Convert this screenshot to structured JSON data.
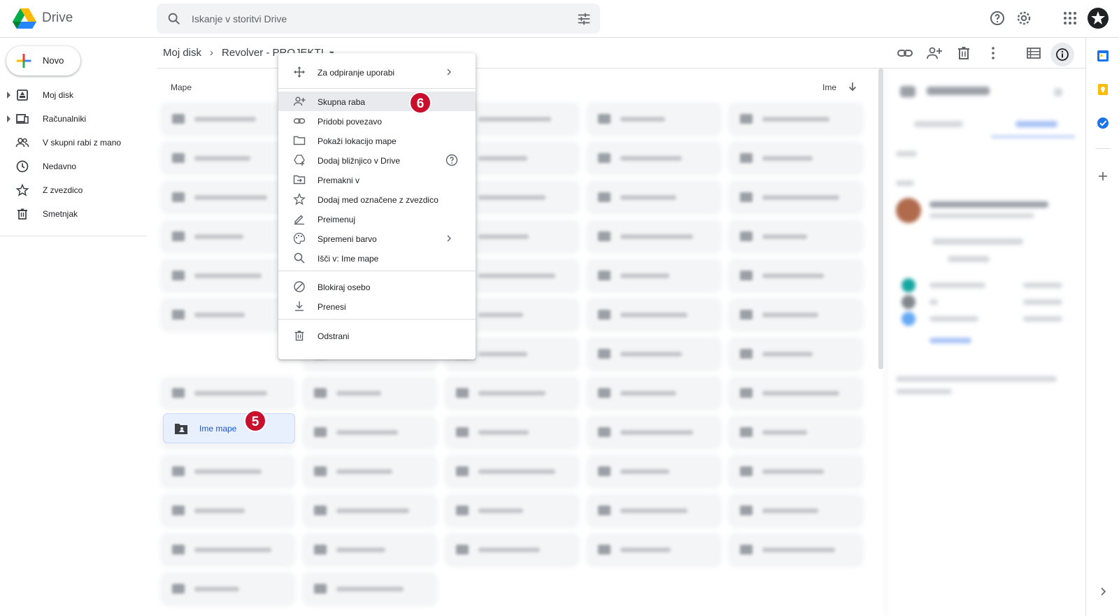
{
  "app": {
    "name": "Drive"
  },
  "search": {
    "placeholder": "Iskanje v storitvi Drive"
  },
  "left_nav": {
    "new_label": "Novo",
    "items": [
      {
        "label": "Moj disk",
        "icon": "my-drive-icon",
        "expandable": true
      },
      {
        "label": "Računalniki",
        "icon": "computers-icon",
        "expandable": true
      },
      {
        "label": "V skupni rabi z mano",
        "icon": "shared-with-me-icon",
        "expandable": false
      },
      {
        "label": "Nedavno",
        "icon": "clock-icon",
        "expandable": false
      },
      {
        "label": "Z zvezdico",
        "icon": "star-icon",
        "expandable": false
      },
      {
        "label": "Smetnjak",
        "icon": "trash-icon",
        "expandable": false
      }
    ]
  },
  "breadcrumb": {
    "root": "Moj disk",
    "current": "Revolver - PROJEKTI"
  },
  "content": {
    "section_label": "Mape",
    "sort_label": "Ime",
    "selected_folder": "Ime mape"
  },
  "badges": {
    "folder": "5",
    "share": "6"
  },
  "context_menu": {
    "items": [
      {
        "label": "Za odpiranje uporabi",
        "icon": "open-with-icon",
        "submenu": true
      },
      {
        "label": "Skupna raba",
        "icon": "share-person-icon",
        "highlighted": true
      },
      {
        "label": "Pridobi povezavo",
        "icon": "link-icon"
      },
      {
        "label": "Pokaži lokacijo mape",
        "icon": "folder-outline-icon"
      },
      {
        "label": "Dodaj bližnjico v Drive",
        "icon": "add-shortcut-icon",
        "help": true
      },
      {
        "label": "Premakni v",
        "icon": "move-to-icon"
      },
      {
        "label": "Dodaj med označene z zvezdico",
        "icon": "star-outline-icon"
      },
      {
        "label": "Preimenuj",
        "icon": "rename-pencil-icon"
      },
      {
        "label": "Spremeni barvo",
        "icon": "palette-icon",
        "submenu": true
      },
      {
        "label": "Išči v: Ime mape",
        "icon": "search-icon"
      },
      {
        "label": "Blokiraj osebo",
        "icon": "block-icon"
      },
      {
        "label": "Prenesi",
        "icon": "download-icon"
      },
      {
        "label": "Odstrani",
        "icon": "trash-icon"
      }
    ]
  },
  "colors": {
    "accent_blue": "#1a73e8",
    "selected_bg": "#e8f0fe",
    "badge_red": "#c8102e",
    "menu_highlight": "#e8eaed"
  }
}
